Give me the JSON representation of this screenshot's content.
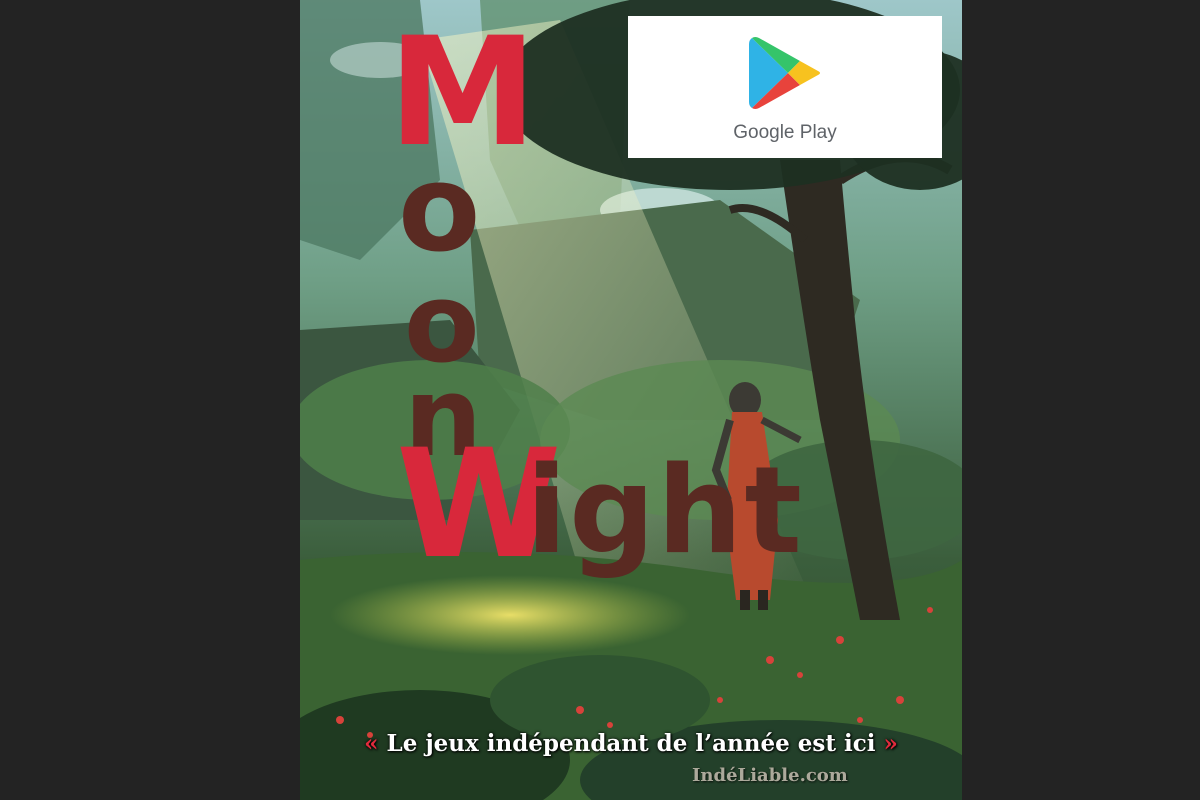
{
  "poster": {
    "title_letters": {
      "M": "M",
      "o1": "o",
      "o2": "o",
      "n": "n",
      "W": "W",
      "ight": "ight"
    },
    "store_badge": {
      "label": "Google Play",
      "icon": "google-play-icon"
    },
    "tagline": {
      "open_quote": "«",
      "text": " Le jeux indépendant de l’année est ici ",
      "close_quote": "»"
    },
    "watermark": "IndéLiable.com"
  },
  "colors": {
    "background": "#232323",
    "title_red": "#d8283b",
    "title_brown": "#5a2a22",
    "quote_red": "#e22a3c"
  }
}
